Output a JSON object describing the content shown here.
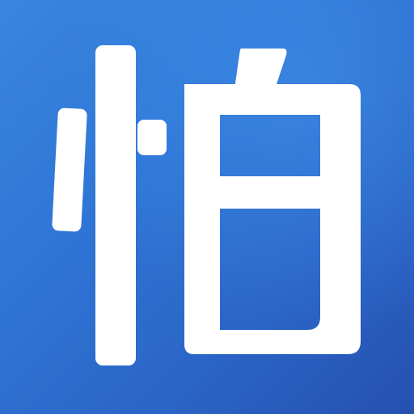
{
  "icon": {
    "glyph": "怕",
    "background_colors": [
      "#3a86e0",
      "#2a64c6",
      "#2650b0"
    ],
    "glyph_color": "#ffffff"
  }
}
